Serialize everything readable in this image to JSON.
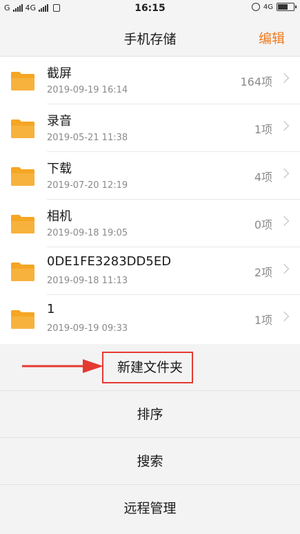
{
  "status_bar": {
    "network_left_1": "G",
    "network_left_2": "4G",
    "time": "16:15",
    "network_right": "4G",
    "battery_level": 0.65
  },
  "header": {
    "title": "手机存储",
    "edit_label": "编辑"
  },
  "folders": [
    {
      "name": "截屏",
      "date": "2019-09-19 16:14",
      "count": "164项"
    },
    {
      "name": "录音",
      "date": "2019-05-21 11:38",
      "count": "1项"
    },
    {
      "name": "下载",
      "date": "2019-07-20 12:19",
      "count": "4项"
    },
    {
      "name": "相机",
      "date": "2019-09-18 19:05",
      "count": "0项"
    },
    {
      "name": "0DE1FE3283DD5ED",
      "date": "2019-09-18 11:13",
      "count": "2项"
    },
    {
      "name": "1",
      "date": "2019-09-19 09:33",
      "count": "1项"
    }
  ],
  "actions": {
    "new_folder": "新建文件夹",
    "sort": "排序",
    "search": "搜索",
    "remote": "远程管理"
  },
  "colors": {
    "accent": "#f07b20",
    "folder": "#f5a623",
    "annotation": "#e53a32"
  }
}
